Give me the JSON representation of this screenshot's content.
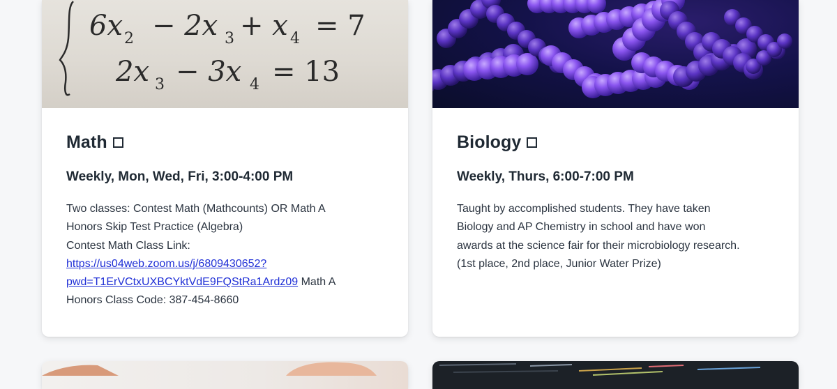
{
  "cards": [
    {
      "title": "Math",
      "schedule": "Weekly, Mon, Wed, Fri, 3:00-4:00 PM",
      "desc_line1": "Two classes: Contest Math (Mathcounts) OR Math A",
      "desc_line2": "Honors Skip Test Practice (Algebra)",
      "desc_line3": "Contest Math Class Link:",
      "link_line1": "https://us04web.zoom.us/j/6809430652?",
      "link_line2": "pwd=T1ErVCtxUXBCYktVdE9FQStRa1Ardz09",
      "desc_after_link": " Math A",
      "desc_line_last": "Honors Class Code: 387-454-8660",
      "image": {
        "eq1_a": "6x",
        "eq1_a_sub": "2",
        "eq1_b": "− 2x",
        "eq1_b_sub": "3",
        "eq1_c": "+ x",
        "eq1_c_sub": "4",
        "eq1_d": "= 7",
        "eq2_a": "2x",
        "eq2_a_sub": "3",
        "eq2_b": "− 3x",
        "eq2_b_sub": "4",
        "eq2_c": "= 13"
      }
    },
    {
      "title": "Biology",
      "schedule": "Weekly, Thurs, 6:00-7:00 PM",
      "desc_line1": "Taught by accomplished students. They have taken",
      "desc_line2": "Biology and AP Chemistry in school and have won",
      "desc_line3": "awards at the science fair for their microbiology research.",
      "desc_line4": "(1st place, 2nd place, Junior Water Prize)"
    }
  ],
  "colors": {
    "link": "#1f2fd6",
    "text": "#1f2933",
    "bacteria": "#7b4be0"
  },
  "icons": {
    "title_marker": "square-icon"
  }
}
